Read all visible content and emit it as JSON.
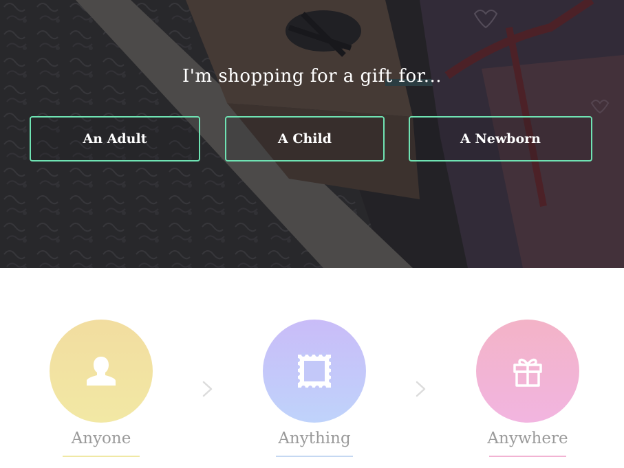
{
  "hero": {
    "title": "I'm shopping for a gift for...",
    "choices": [
      {
        "label": "An Adult"
      },
      {
        "label": "A Child"
      },
      {
        "label": "A Newborn"
      }
    ],
    "accent_color": "#6fe3b3"
  },
  "features": {
    "items": [
      {
        "label": "Anyone",
        "icon": "person-icon",
        "circle_color": "#f2e0a0",
        "underline_color": "#f0e8a4"
      },
      {
        "label": "Anything",
        "icon": "stamp-icon",
        "circle_color": "#c5c6f8",
        "underline_color": "#c5d8f2"
      },
      {
        "label": "Anywhere",
        "icon": "gift-icon",
        "circle_color": "#f3b4d0",
        "underline_color": "#f2b3d3"
      }
    ],
    "separator_icon": "chevron-right-icon"
  }
}
